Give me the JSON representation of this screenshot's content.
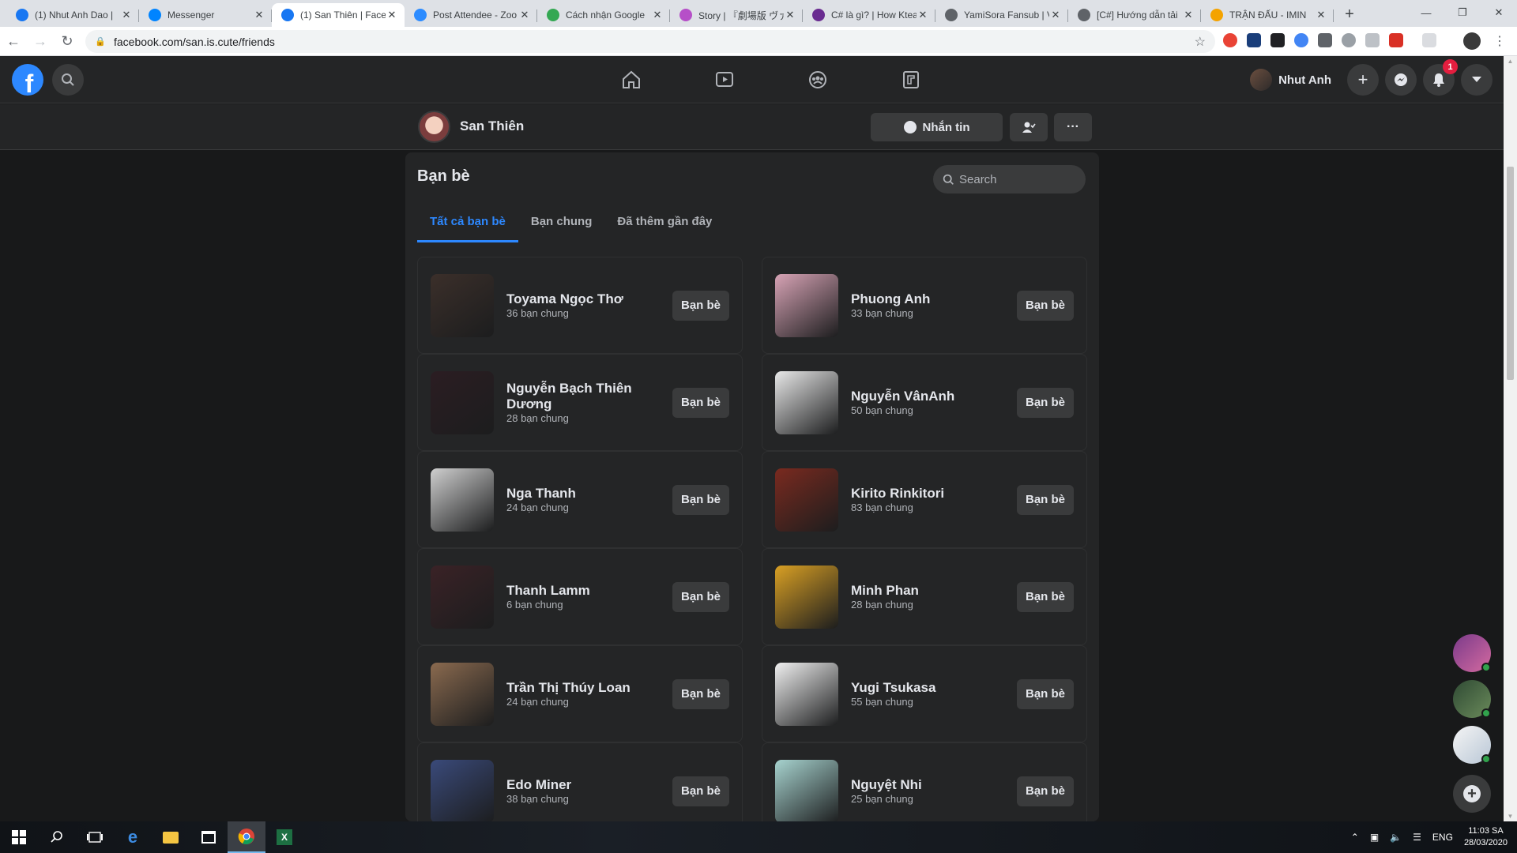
{
  "browser": {
    "tabs": [
      {
        "label": "(1) Nhut Anh Dao |",
        "icon": "facebook-icon",
        "color": "#1877f2"
      },
      {
        "label": "Messenger",
        "icon": "messenger-icon",
        "color": "#0084ff"
      },
      {
        "label": "(1) San Thiên | Face",
        "icon": "facebook-icon",
        "color": "#1877f2",
        "active": true
      },
      {
        "label": "Post Attendee - Zoo",
        "icon": "zoom-icon",
        "color": "#2d8cff"
      },
      {
        "label": "Cách nhận Google",
        "icon": "check-icon",
        "color": "#34a853"
      },
      {
        "label": "Story | 『劇場版 ヴァ",
        "icon": "story-icon",
        "color": "#b64fc8"
      },
      {
        "label": "C# là gì? | How Ktea",
        "icon": "k-icon",
        "color": "#6a2c91"
      },
      {
        "label": "YamiSora Fansub | V",
        "icon": "globe-icon",
        "color": "#5f6368"
      },
      {
        "label": "[C#] Hướng dẫn tải",
        "icon": "globe-icon",
        "color": "#5f6368"
      },
      {
        "label": "TRẬN ĐẤU - IMIN",
        "icon": "imin-icon",
        "color": "#f4a300"
      }
    ],
    "close_glyph": "✕",
    "new_tab_glyph": "+",
    "url": "facebook.com/san.is.cute/friends"
  },
  "fb": {
    "logo_letter": "f",
    "user_name": "Nhut Anh",
    "notification_count": "1",
    "profile_name": "San Thiên",
    "message_button": "Nhắn tin",
    "more_glyph": "···"
  },
  "friends": {
    "title": "Bạn bè",
    "search_placeholder": "Search",
    "tabs": [
      "Tất cả bạn bè",
      "Bạn chung",
      "Đã thêm gần đây"
    ],
    "button_label": "Bạn bè",
    "list": [
      {
        "name": "Toyama Ngọc Thơ",
        "mutual": "36 bạn chung",
        "color": "#3b2f2a"
      },
      {
        "name": "Phuong Anh",
        "mutual": "33 bạn chung",
        "color": "#d7a3b5"
      },
      {
        "name": "Nguyễn Bạch Thiên Dương",
        "mutual": "28 bạn chung",
        "color": "#2b1d22"
      },
      {
        "name": "Nguyễn VânAnh",
        "mutual": "50 bạn chung",
        "color": "#e8e8e8"
      },
      {
        "name": "Nga Thanh",
        "mutual": "24 bạn chung",
        "color": "#cfcfcf"
      },
      {
        "name": "Kirito Rinkitori",
        "mutual": "83 bạn chung",
        "color": "#7a2a1f"
      },
      {
        "name": "Thanh Lamm",
        "mutual": "6 bạn chung",
        "color": "#3a2226"
      },
      {
        "name": "Minh Phan",
        "mutual": "28 bạn chung",
        "color": "#d9a024"
      },
      {
        "name": "Trần Thị Thúy Loan",
        "mutual": "24 bạn chung",
        "color": "#8a6a4f"
      },
      {
        "name": "Yugi Tsukasa",
        "mutual": "55 bạn chung",
        "color": "#f0f0f0"
      },
      {
        "name": "Edo Miner",
        "mutual": "38 bạn chung",
        "color": "#3a4a7a"
      },
      {
        "name": "Nguyệt Nhi",
        "mutual": "25 bạn chung",
        "color": "#a7d3cf"
      }
    ]
  },
  "taskbar": {
    "language": "ENG",
    "time": "11:03 SA",
    "date": "28/03/2020"
  }
}
